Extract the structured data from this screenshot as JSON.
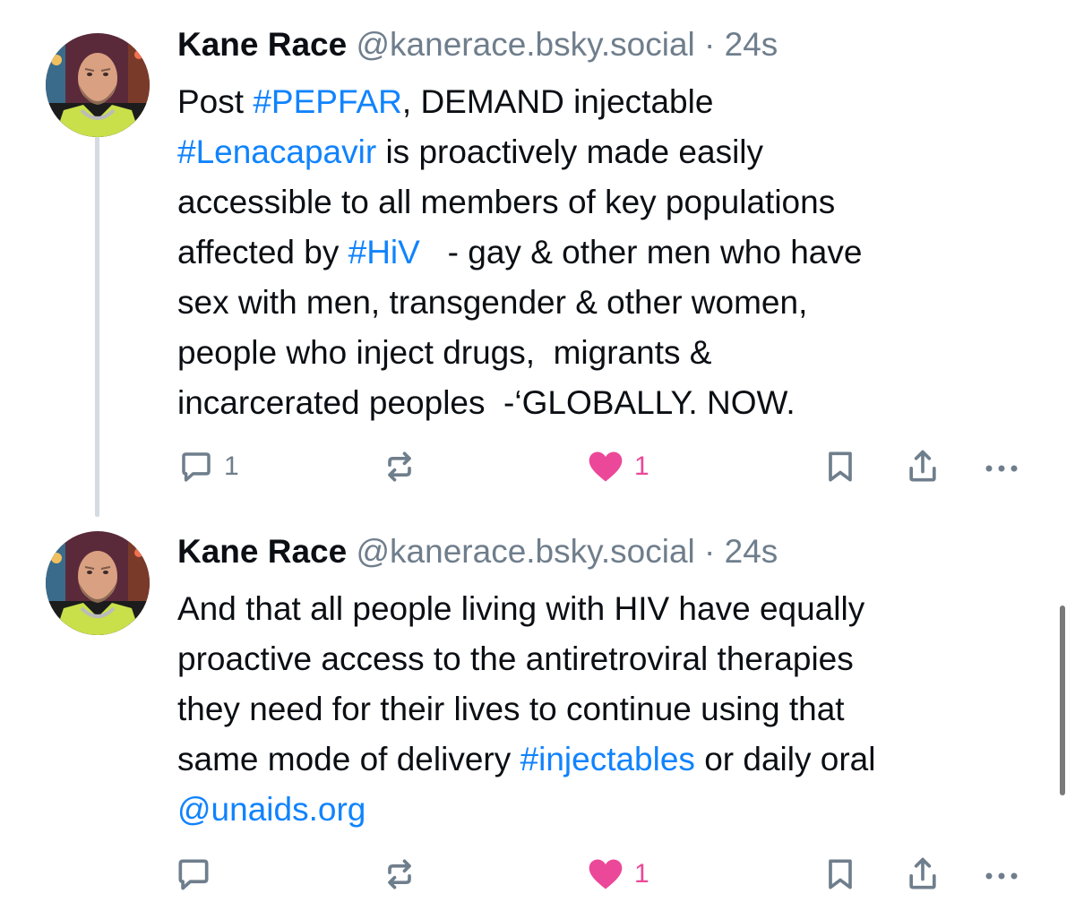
{
  "colors": {
    "link": "#1083fe",
    "muted": "#6f7e8c",
    "like": "#ec4899",
    "thread_line": "#d4dbe2"
  },
  "posts": [
    {
      "author_name": "Kane Race",
      "handle": "@kanerace.bsky.social",
      "separator": "·",
      "time": "24s",
      "lines": [
        [
          {
            "t": "Post ",
            "link": false
          },
          {
            "t": "#PEPFAR",
            "link": true
          },
          {
            "t": ", DEMAND injectable",
            "link": false
          }
        ],
        [
          {
            "t": "#Lenacapavir",
            "link": true
          },
          {
            "t": " is proactively made easily",
            "link": false
          }
        ],
        [
          {
            "t": "accessible to all members of key populations",
            "link": false
          }
        ],
        [
          {
            "t": "affected by ",
            "link": false
          },
          {
            "t": "#HiV",
            "link": true
          },
          {
            "t": "   - gay & other men who have",
            "link": false
          }
        ],
        [
          {
            "t": "sex with men, transgender & other women,",
            "link": false
          }
        ],
        [
          {
            "t": "people who inject drugs,  migrants &",
            "link": false
          }
        ],
        [
          {
            "t": "incarcerated peoples  -‘GLOBALLY. NOW.",
            "link": false
          }
        ]
      ],
      "reply_icon": "reply-bubble-icon",
      "reply_count": "1",
      "repost_icon": "repost-icon",
      "repost_count": "",
      "like_icon": "heart-filled-icon",
      "like_count": "1",
      "liked": true,
      "bookmark_icon": "bookmark-icon",
      "share_icon": "share-icon",
      "more_icon": "more-dots-icon"
    },
    {
      "author_name": "Kane Race",
      "handle": "@kanerace.bsky.social",
      "separator": "·",
      "time": "24s",
      "lines": [
        [
          {
            "t": "And that all people living with HIV have equally",
            "link": false
          }
        ],
        [
          {
            "t": "proactive access to the antiretroviral therapies",
            "link": false
          }
        ],
        [
          {
            "t": "they need for their lives to continue using that",
            "link": false
          }
        ],
        [
          {
            "t": "same mode of delivery ",
            "link": false
          },
          {
            "t": "#injectables",
            "link": true
          },
          {
            "t": " or daily oral",
            "link": false
          }
        ],
        [
          {
            "t": "@unaids.org",
            "link": true
          }
        ]
      ],
      "reply_icon": "reply-bubble-icon",
      "reply_count": "",
      "repost_icon": "repost-icon",
      "repost_count": "",
      "like_icon": "heart-filled-icon",
      "like_count": "1",
      "liked": true,
      "bookmark_icon": "bookmark-icon",
      "share_icon": "share-icon",
      "more_icon": "more-dots-icon"
    }
  ]
}
